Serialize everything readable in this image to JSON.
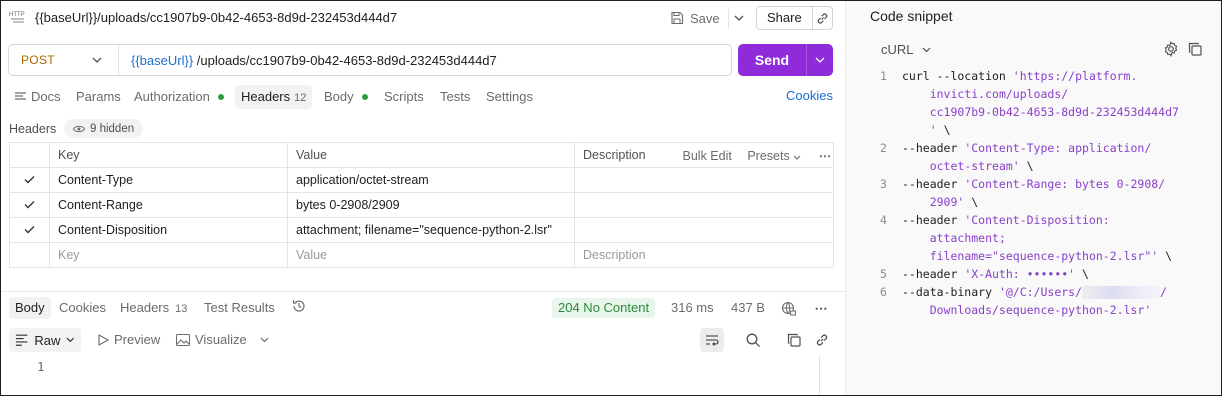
{
  "request": {
    "http_badge": "HTTP",
    "title": "{{baseUrl}}/uploads/cc1907b9-0b42-4653-8d9d-232453d444d7",
    "save_label": "Save",
    "share_label": "Share",
    "method": "POST",
    "url_var": "{{baseUrl}}",
    "url_path": " /uploads/cc1907b9-0b42-4653-8d9d-232453d444d7",
    "send_label": "Send"
  },
  "tabs": [
    {
      "label": "Docs"
    },
    {
      "label": "Params"
    },
    {
      "label": "Authorization",
      "dot": true
    },
    {
      "label": "Headers",
      "count": "12",
      "active": true
    },
    {
      "label": "Body",
      "dot": true
    },
    {
      "label": "Scripts"
    },
    {
      "label": "Tests"
    },
    {
      "label": "Settings"
    }
  ],
  "cookies_link": "Cookies",
  "headers_section": {
    "label": "Headers",
    "hidden_label": "9 hidden",
    "columns": {
      "key": "Key",
      "value": "Value",
      "description": "Description"
    },
    "bulk_edit": "Bulk Edit",
    "presets": "Presets",
    "rows": [
      {
        "key": "Content-Type",
        "value": "application/octet-stream",
        "description": "",
        "checked": true
      },
      {
        "key": "Content-Range",
        "value": "bytes 0-2908/2909",
        "description": "",
        "checked": true
      },
      {
        "key": "Content-Disposition",
        "value": "attachment; filename=\"sequence-python-2.lsr\"",
        "description": "",
        "checked": true
      }
    ],
    "placeholder": {
      "key": "Key",
      "value": "Value",
      "description": "Description"
    }
  },
  "response": {
    "tabs": [
      {
        "label": "Body",
        "active": true
      },
      {
        "label": "Cookies"
      },
      {
        "label": "Headers",
        "count": "13"
      },
      {
        "label": "Test Results"
      }
    ],
    "status": "204 No Content",
    "time": "316 ms",
    "size": "437 B",
    "view_mode": "Raw",
    "preview_label": "Preview",
    "visualize_label": "Visualize",
    "line_number": "1"
  },
  "snippet": {
    "title": "Code snippet",
    "language": "cURL",
    "lines": [
      {
        "n": "1",
        "segs": [
          {
            "t": "curl --location "
          },
          {
            "t": "'https://platform.",
            "s": true
          }
        ]
      },
      {
        "n": "",
        "segs": [
          {
            "t": "    "
          },
          {
            "t": "invicti.com/uploads/",
            "s": true
          }
        ]
      },
      {
        "n": "",
        "segs": [
          {
            "t": "    "
          },
          {
            "t": "cc1907b9-0b42-4653-8d9d-232453d444d7",
            "s": true
          }
        ]
      },
      {
        "n": "",
        "segs": [
          {
            "t": "    "
          },
          {
            "t": "'",
            "s": true
          },
          {
            "t": " \\"
          }
        ]
      },
      {
        "n": "2",
        "segs": [
          {
            "t": "--header "
          },
          {
            "t": "'Content-Type: application/",
            "s": true
          }
        ]
      },
      {
        "n": "",
        "segs": [
          {
            "t": "    "
          },
          {
            "t": "octet-stream'",
            "s": true
          },
          {
            "t": " \\"
          }
        ]
      },
      {
        "n": "3",
        "segs": [
          {
            "t": "--header "
          },
          {
            "t": "'Content-Range: bytes 0-2908/",
            "s": true
          }
        ]
      },
      {
        "n": "",
        "segs": [
          {
            "t": "    "
          },
          {
            "t": "2909'",
            "s": true
          },
          {
            "t": " \\"
          }
        ]
      },
      {
        "n": "4",
        "segs": [
          {
            "t": "--header "
          },
          {
            "t": "'Content-Disposition:",
            "s": true
          }
        ]
      },
      {
        "n": "",
        "segs": [
          {
            "t": "    "
          },
          {
            "t": "attachment;",
            "s": true
          }
        ]
      },
      {
        "n": "",
        "segs": [
          {
            "t": "    "
          },
          {
            "t": "filename=\"sequence-python-2.lsr\"'",
            "s": true
          },
          {
            "t": " \\"
          }
        ]
      },
      {
        "n": "5",
        "segs": [
          {
            "t": "--header "
          },
          {
            "t": "'X-Auth: ••••••'",
            "s": true
          },
          {
            "t": " \\"
          }
        ]
      },
      {
        "n": "6",
        "segs": [
          {
            "t": "--data-binary "
          },
          {
            "t": "'@/C:/Users/",
            "s": true
          },
          {
            "t": "",
            "blur": true
          },
          {
            "t": "/",
            "s": true
          }
        ]
      },
      {
        "n": "",
        "segs": [
          {
            "t": "    "
          },
          {
            "t": "Downloads/sequence-python-2.lsr'",
            "s": true
          }
        ]
      }
    ]
  },
  "colors": {
    "accent": "#8f2bd9",
    "method": "#a86a00",
    "link": "#1c6fd1",
    "status_ok": "#2a8a3b",
    "string": "#8a3fc9"
  }
}
